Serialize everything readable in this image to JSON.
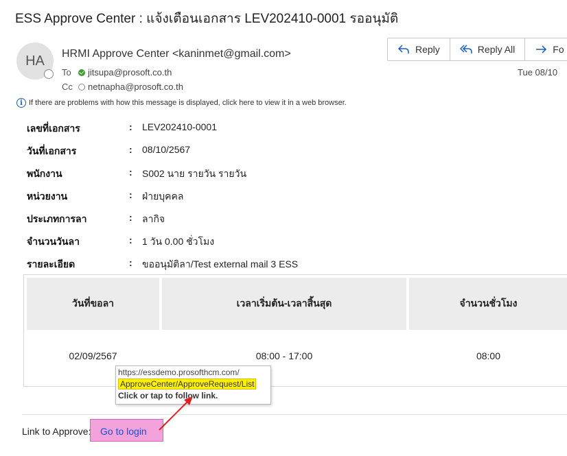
{
  "email": {
    "subject": "ESS Approve Center : แจ้งเตือนเอกสาร LEV202410-0001 รออนุมัติ",
    "avatar_initials": "HA",
    "sender": "HRMI Approve Center <kaninmet@gmail.com>",
    "to_label": "To",
    "to_value": "jitsupa@prosoft.co.th",
    "cc_label": "Cc",
    "cc_value": "netnapha@prosoft.co.th",
    "date": "Tue 08/10",
    "info_text": "If there are problems with how this message is displayed, click here to view it in a web browser."
  },
  "actions": {
    "reply": "Reply",
    "reply_all": "Reply All",
    "forward": "Fo"
  },
  "fields": [
    {
      "label": "เลขที่เอกสาร",
      "colon": ":",
      "value": "LEV202410-0001"
    },
    {
      "label": "วันที่เอกสาร",
      "colon": ":",
      "value": "08/10/2567"
    },
    {
      "label": "พนักงาน",
      "colon": ":",
      "value": "S002 นาย รายวัน รายวัน"
    },
    {
      "label": "หน่วยงาน",
      "colon": ":",
      "value": "ฝ่ายบุคคล"
    },
    {
      "label": "ประเภทการลา",
      "colon": ":",
      "value": "ลากิจ"
    },
    {
      "label": "จำนวนวันลา",
      "colon": ":",
      "value": "1 วัน 0.00 ชั่วโมง"
    },
    {
      "label": "รายละเอียด",
      "colon": ":",
      "value": "ขออนุมัติลา/Test external mail 3 ESS"
    }
  ],
  "table": {
    "headers": [
      "วันที่ขอลา",
      "เวลาเริ่มต้น-เวลาสิ้นสุด",
      "จำนวนชั่วโมง"
    ],
    "rows": [
      [
        "02/09/2567",
        "08:00 - 17:00",
        "08:00"
      ]
    ]
  },
  "link": {
    "label": "Link to Approve:",
    "text": "Go to login"
  },
  "tooltip": {
    "url_line1": "https://essdemo.prosofthcm.com/",
    "url_line2": "ApproveCenter/ApproveRequest/List",
    "hint": "Click or tap to follow link."
  },
  "colors": {
    "link": "#1a4fd6",
    "highlight_pink": "#f3a3dc",
    "highlight_yellow": "#fff200",
    "arrow": "#e02020",
    "header_bg": "#ececec"
  }
}
